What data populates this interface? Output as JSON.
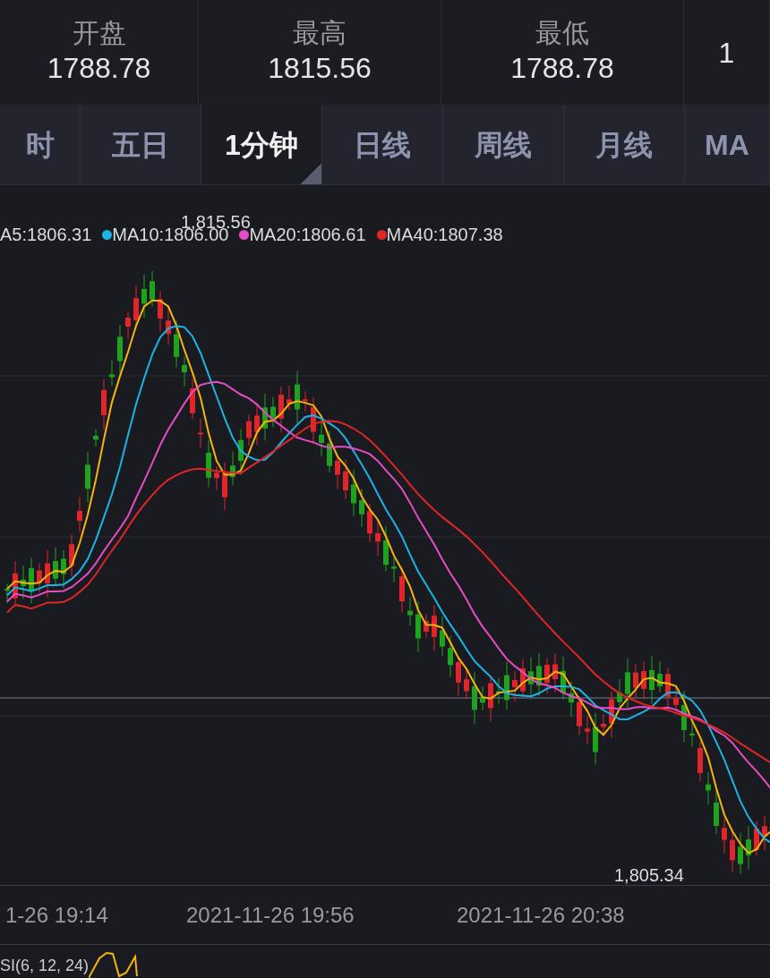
{
  "stats": [
    {
      "label": "开盘",
      "value": "1788.78"
    },
    {
      "label": "最高",
      "value": "1815.56"
    },
    {
      "label": "最低",
      "value": "1788.78"
    },
    {
      "value": "1"
    }
  ],
  "tabs": [
    {
      "label": "时",
      "selected": false
    },
    {
      "label": "五日",
      "selected": false
    },
    {
      "label": "1分钟",
      "selected": true
    },
    {
      "label": "日线",
      "selected": false
    },
    {
      "label": "周线",
      "selected": false
    },
    {
      "label": "月线",
      "selected": false
    },
    {
      "label": "MA",
      "selected": false
    }
  ],
  "legend": [
    {
      "text": "A5:1806.31",
      "color": "#f5b40f",
      "dot": false
    },
    {
      "text": "MA10:1806.00",
      "color": "#1cb3e6",
      "dot": true
    },
    {
      "text": "MA20:1806.61",
      "color": "#e64cc3",
      "dot": true
    },
    {
      "text": "MA40:1807.38",
      "color": "#df2626",
      "dot": true
    }
  ],
  "chart": {
    "high_label": "1,815.56",
    "low_label": "1,805.34"
  },
  "time_axis": [
    "1-26 19:14",
    "2021-11-26 19:56",
    "2021-11-26 20:38"
  ],
  "indicator": {
    "label": "SI(6, 12, 24)"
  }
}
